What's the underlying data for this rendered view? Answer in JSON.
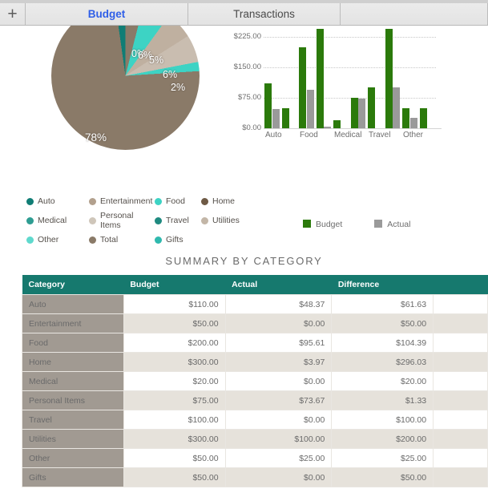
{
  "tabs": {
    "add_label": "+",
    "items": [
      {
        "label": "Budget",
        "active": true
      },
      {
        "label": "Transactions",
        "active": false
      }
    ]
  },
  "pie_legend": [
    {
      "label": "Auto",
      "color": "#107d75"
    },
    {
      "label": "Entertainment",
      "color": "#b2a08d"
    },
    {
      "label": "Food",
      "color": "#3dd3c4"
    },
    {
      "label": "Home",
      "color": "#6e5a45"
    },
    {
      "label": "Medical",
      "color": "#2e9d92"
    },
    {
      "label": "Personal Items",
      "color": "#cfc6ba"
    },
    {
      "label": "Travel",
      "color": "#1f8a80"
    },
    {
      "label": "Utilities",
      "color": "#c3b6a7"
    },
    {
      "label": "Other",
      "color": "#5fd9cd"
    },
    {
      "label": "Total",
      "color": "#8a7a68"
    },
    {
      "label": "Gifts",
      "color": "#2fb9ae"
    }
  ],
  "bar_legend": [
    {
      "label": "Budget",
      "color": "#2b7a0b"
    },
    {
      "label": "Actual",
      "color": "#9a9a9a"
    }
  ],
  "summary": {
    "title": "SUMMARY BY CATEGORY",
    "columns": [
      "Category",
      "Budget",
      "Actual",
      "Difference",
      ""
    ],
    "rows": [
      {
        "category": "Auto",
        "budget": "$110.00",
        "actual": "$48.37",
        "difference": "$61.63"
      },
      {
        "category": "Entertainment",
        "budget": "$50.00",
        "actual": "$0.00",
        "difference": "$50.00"
      },
      {
        "category": "Food",
        "budget": "$200.00",
        "actual": "$95.61",
        "difference": "$104.39"
      },
      {
        "category": "Home",
        "budget": "$300.00",
        "actual": "$3.97",
        "difference": "$296.03"
      },
      {
        "category": "Medical",
        "budget": "$20.00",
        "actual": "$0.00",
        "difference": "$20.00"
      },
      {
        "category": "Personal Items",
        "budget": "$75.00",
        "actual": "$73.67",
        "difference": "$1.33"
      },
      {
        "category": "Travel",
        "budget": "$100.00",
        "actual": "$0.00",
        "difference": "$100.00"
      },
      {
        "category": "Utilities",
        "budget": "$300.00",
        "actual": "$100.00",
        "difference": "$200.00"
      },
      {
        "category": "Other",
        "budget": "$50.00",
        "actual": "$25.00",
        "difference": "$25.00"
      },
      {
        "category": "Gifts",
        "budget": "$50.00",
        "actual": "$0.00",
        "difference": "$50.00"
      }
    ]
  },
  "chart_data": [
    {
      "type": "pie",
      "title": "",
      "labels_shown": [
        "0%",
        "6%",
        "5%",
        "6%",
        "2%",
        "78%"
      ],
      "categories": [
        "Auto",
        "Entertainment",
        "Food",
        "Home",
        "Medical",
        "Personal Items",
        "Travel",
        "Utilities",
        "Other",
        "Total",
        "Gifts"
      ],
      "slices": [
        {
          "label": "Total",
          "percent": 78,
          "display": "78%",
          "color": "#8a7a68"
        },
        {
          "label": "Auto",
          "percent": 0,
          "display": "0%",
          "color": "#107d75"
        },
        {
          "label": "Food",
          "percent": 6,
          "display": "6%",
          "color": "#3dd3c4"
        },
        {
          "label": "Personal Items",
          "percent": 5,
          "display": "5%",
          "color": "#cfc6ba"
        },
        {
          "label": "Entertainment",
          "percent": 6,
          "display": "6%",
          "color": "#b2a08d"
        },
        {
          "label": "Gifts",
          "percent": 2,
          "display": "2%",
          "color": "#3dd3c4"
        }
      ],
      "legend_position": "bottom"
    },
    {
      "type": "bar",
      "title": "",
      "xlabel": "",
      "ylabel": "",
      "categories": [
        "Auto",
        "Entertainment",
        "Food",
        "Home",
        "Medical",
        "Personal Items",
        "Travel",
        "Utilities",
        "Other",
        "Gifts"
      ],
      "tick_labels_shown": [
        "Auto",
        "Food",
        "Medical",
        "Travel",
        "Other"
      ],
      "ytick_labels": [
        "$0.00",
        "$75.00",
        "$150.00",
        "$225.00"
      ],
      "ylim": [
        0,
        300
      ],
      "grid": true,
      "legend_position": "bottom",
      "series": [
        {
          "name": "Budget",
          "color": "#2b7a0b",
          "values": [
            110,
            50,
            200,
            300,
            20,
            75,
            100,
            300,
            50,
            50
          ]
        },
        {
          "name": "Actual",
          "color": "#9a9a9a",
          "values": [
            48.37,
            0,
            95.61,
            3.97,
            0,
            73.67,
            0,
            100,
            25,
            0
          ]
        }
      ]
    }
  ]
}
